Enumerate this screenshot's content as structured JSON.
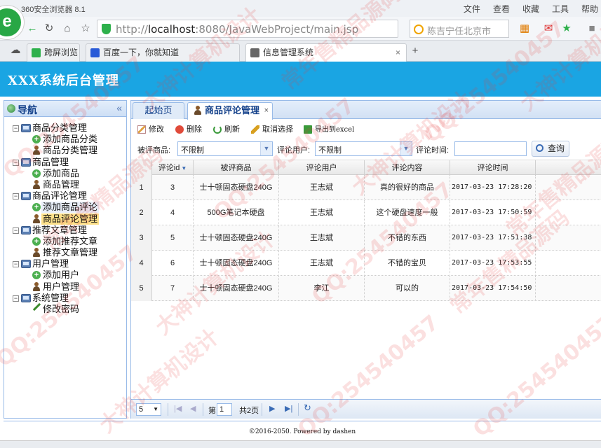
{
  "browser": {
    "app_title": "360安全浏览器 8.1",
    "logo_letter": "e",
    "menu": [
      "文件",
      "查看",
      "收藏",
      "工具",
      "帮助"
    ],
    "url_prefix": "http://",
    "url_host": "localhost",
    "url_rest": ":8080/JavaWebProject/main.jsp",
    "search_placeholder": "陈吉宁任北京市",
    "tabs": [
      {
        "label": "跨屏浏览",
        "active": false,
        "color": "#2db04b"
      },
      {
        "label": "百度一下，你就知道",
        "active": false,
        "color": "#2a5bd7"
      },
      {
        "label": "信息管理系统",
        "active": true,
        "color": "#666666"
      }
    ],
    "new_tab": "+"
  },
  "app": {
    "title": "XXX系统后台管理",
    "header_color": "#1aa5e3"
  },
  "sidebar": {
    "title": "导航",
    "collapse_glyph": "«",
    "tree": [
      {
        "level": 1,
        "label": "商品分类管理"
      },
      {
        "level": 2,
        "label": "添加商品分类",
        "icon": "add"
      },
      {
        "level": 2,
        "label": "商品分类管理",
        "icon": "user"
      },
      {
        "level": 1,
        "label": "商品管理"
      },
      {
        "level": 2,
        "label": "添加商品",
        "icon": "add"
      },
      {
        "level": 2,
        "label": "商品管理",
        "icon": "user"
      },
      {
        "level": 1,
        "label": "商品评论管理"
      },
      {
        "level": 2,
        "label": "添加商品评论",
        "icon": "add",
        "state": "hover"
      },
      {
        "level": 2,
        "label": "商品评论管理",
        "icon": "user",
        "state": "selected"
      },
      {
        "level": 1,
        "label": "推荐文章管理"
      },
      {
        "level": 2,
        "label": "添加推荐文章",
        "icon": "add"
      },
      {
        "level": 2,
        "label": "推荐文章管理",
        "icon": "user"
      },
      {
        "level": 1,
        "label": "用户管理"
      },
      {
        "level": 2,
        "label": "添加用户",
        "icon": "add"
      },
      {
        "level": 2,
        "label": "用户管理",
        "icon": "user"
      },
      {
        "level": 1,
        "label": "系统管理"
      },
      {
        "level": 2,
        "label": "修改密码",
        "icon": "pen"
      }
    ]
  },
  "tabs": {
    "home": "起始页",
    "active": "商品评论管理",
    "close": "×"
  },
  "toolbar": {
    "edit": "修改",
    "delete": "删除",
    "refresh": "刷新",
    "cancel_select": "取消选择",
    "export": "导出到excel"
  },
  "filter": {
    "product_label": "被评商品:",
    "product_value": "不限制",
    "user_label": "评论用户:",
    "user_value": "不限制",
    "time_label": "评论时间:",
    "time_value": "",
    "query_button": "查询"
  },
  "grid": {
    "columns": [
      "评论id",
      "被评商品",
      "评论用户",
      "评论内容",
      "评论时间"
    ],
    "rows": [
      {
        "rn": "1",
        "id": "3",
        "product": "士十顿固态硬盘240G",
        "user": "王志斌",
        "content": "真的很好的商品",
        "time": "2017-03-23 17:28:20"
      },
      {
        "rn": "2",
        "id": "4",
        "product": "500G笔记本硬盘",
        "user": "王志斌",
        "content": "这个硬盘速度一般",
        "time": "2017-03-23 17:50:59"
      },
      {
        "rn": "3",
        "id": "5",
        "product": "士十顿固态硬盘240G",
        "user": "王志斌",
        "content": "不错的东西",
        "time": "2017-03-23 17:51:38"
      },
      {
        "rn": "4",
        "id": "6",
        "product": "士十顿固态硬盘240G",
        "user": "王志斌",
        "content": "不错的宝贝",
        "time": "2017-03-23 17:53:55"
      },
      {
        "rn": "5",
        "id": "7",
        "product": "士十顿固态硬盘240G",
        "user": "李江",
        "content": "可以的",
        "time": "2017-03-23 17:54:50"
      }
    ]
  },
  "pager": {
    "page_size": "5",
    "page_label": "第",
    "page_number": "1",
    "total": "共2页"
  },
  "footer": {
    "text": "©2016-2050. Powered by dashen"
  },
  "watermarks": [
    "QQ:254540457",
    "大神计算机设计",
    "常年售精品源码",
    "QQ:254540457",
    "大神计算机设计",
    "常年售精品源码",
    "QQ:254540457",
    "大神计算机设计",
    "常年售精品源码",
    "QQ:254540457",
    "大神计算机设计",
    "QQ:254540457",
    "常年售精品源码",
    "大神计算机设计",
    "QQ:254540457",
    "QQ:254540457"
  ]
}
